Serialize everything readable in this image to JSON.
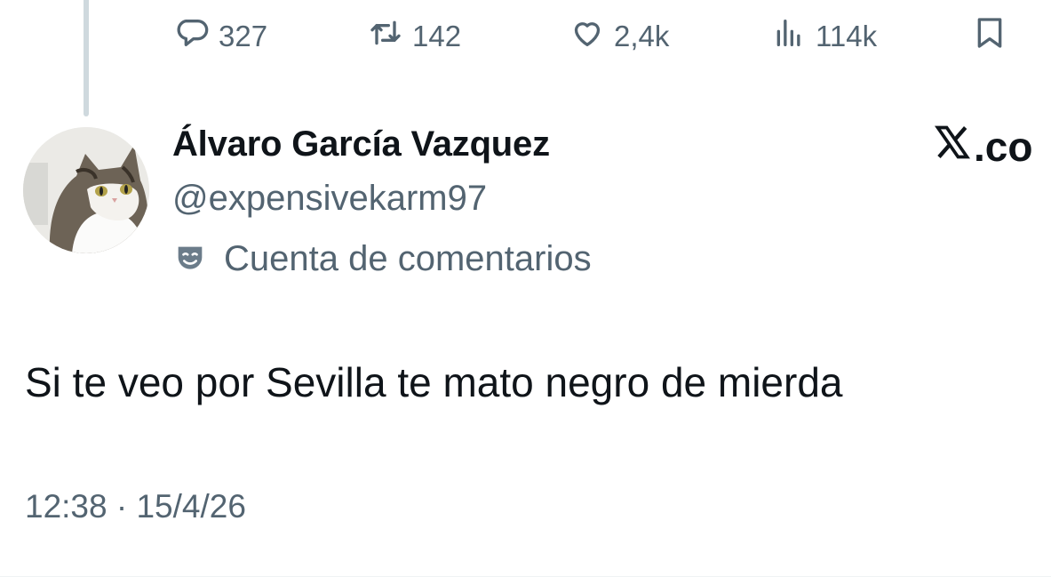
{
  "actions": {
    "reply_count": "327",
    "retweet_count": "142",
    "like_count": "2,4k",
    "view_count": "114k"
  },
  "icons": {
    "reply": "comment-bubble-icon",
    "retweet": "retweet-arrows-icon",
    "like": "heart-icon",
    "views": "bar-chart-icon",
    "bookmark": "bookmark-icon",
    "label": "theater-mask-icon",
    "brand": "x-logo-icon"
  },
  "author": {
    "display_name": "Álvaro García Vazquez",
    "handle": "@expensivekarm97",
    "label": "Cuenta de comentarios"
  },
  "brand": {
    "suffix": ".co"
  },
  "tweet": {
    "text": "Si te veo por Sevilla te mato negro de mierda",
    "timestamp": "12:38 · 15/4/26"
  },
  "colors": {
    "text_primary": "#0f1419",
    "text_secondary": "#536471",
    "thread_line": "#cfd9de",
    "background": "#ffffff"
  }
}
